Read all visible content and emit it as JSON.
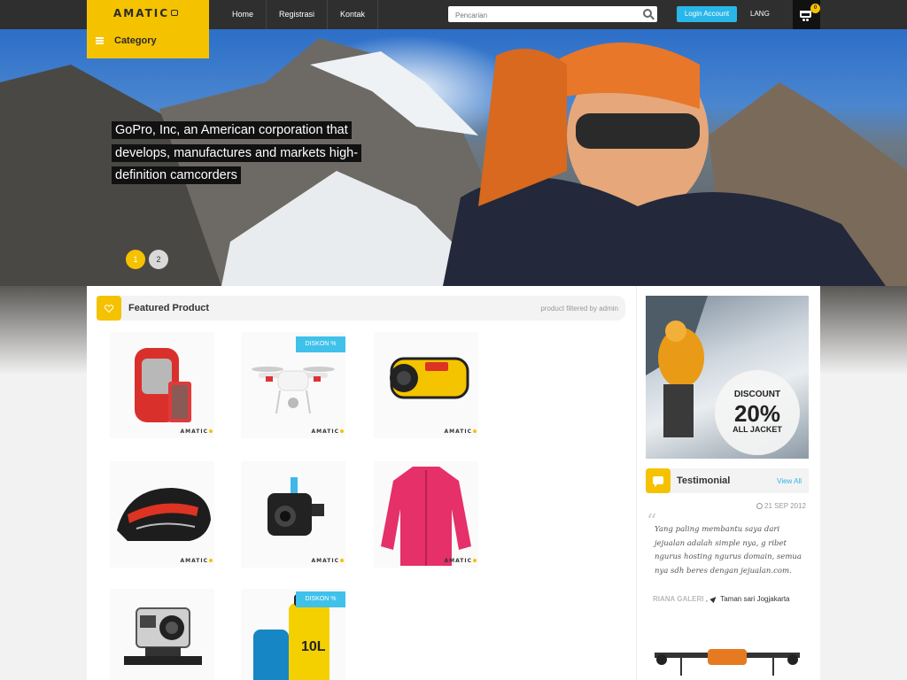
{
  "header": {
    "logo_text": "AMATIC",
    "category_label": "Category",
    "nav": [
      "Home",
      "Registrasi",
      "Kontak"
    ],
    "search_placeholder": "Pencarian",
    "login_label": "Login Account",
    "lang_label": "LANG",
    "cart_count": "0"
  },
  "hero": {
    "caption": "GoPro, Inc, an American corporation that develops, manufactures and markets high-definition camcorders",
    "slides": [
      "1",
      "2"
    ],
    "active_slide": 0
  },
  "featured": {
    "title": "Featured Product",
    "filter_text": "product filtered by admin",
    "products": [
      {
        "name": "backpack",
        "badge": ""
      },
      {
        "name": "drone",
        "badge": "DISKON %"
      },
      {
        "name": "kodak-camera",
        "badge": ""
      },
      {
        "name": "helmet",
        "badge": ""
      },
      {
        "name": "action-cam",
        "badge": ""
      },
      {
        "name": "pink-jacket",
        "badge": ""
      },
      {
        "name": "gopro",
        "badge": ""
      },
      {
        "name": "dry-bags",
        "badge": "DISKON %"
      }
    ],
    "product_logo": "AMATIC"
  },
  "sidebar": {
    "ad": {
      "line1": "DISCOUNT",
      "line2": "20%",
      "line3": "ALL JACKET"
    },
    "testimonial": {
      "title": "Testimonial",
      "view_all": "View All",
      "date": "21 SEP 2012",
      "quote": "Yang paling membantu saya dari jejualan adalah simple nya, g ribet ngurus hosting ngurus domain, semua nya sdh beres dengan jejualan.com.",
      "author": "RIANA GALERI",
      "location": "Taman sari Jogjakarta"
    }
  },
  "colors": {
    "accent": "#f5c200",
    "link": "#29b6e8",
    "topbar": "#2f2f2f"
  }
}
